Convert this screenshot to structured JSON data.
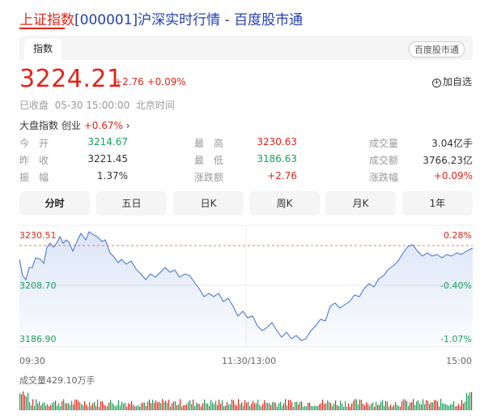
{
  "title": {
    "name": "上证指数",
    "code": "[000001]",
    "suffix": "沪深实时行情 - 百度股市通"
  },
  "tab": {
    "index_label": "指数",
    "brand_label": "百度股市通"
  },
  "quote": {
    "price": "3224.21",
    "change": "+2.76",
    "change_pct": "+0.09%"
  },
  "favorite_label": "加自选",
  "status": {
    "state": "已收盘",
    "time": "05-30 15:00:00",
    "tz": "北京时间"
  },
  "market": {
    "label": "大盘指数",
    "board": "创业",
    "board_chg": "+0.67%"
  },
  "stats": [
    {
      "l1": "今　开",
      "v1": "3214.67",
      "c1": "down",
      "l2": "最　高",
      "v2": "3230.63",
      "c2": "up",
      "l3": "成交量",
      "v3": "3.04亿手",
      "c3": ""
    },
    {
      "l1": "昨　收",
      "v1": "3221.45",
      "c1": "",
      "l2": "最　低",
      "v2": "3186.63",
      "c2": "down",
      "l3": "成交额",
      "v3": "3766.23亿",
      "c3": ""
    },
    {
      "l1": "振　幅",
      "v1": "1.37%",
      "c1": "",
      "l2": "涨跌额",
      "v2": "+2.76",
      "c2": "up",
      "l3": "涨跌幅",
      "v3": "+0.09%",
      "c3": "up"
    }
  ],
  "periods": [
    "分时",
    "五日",
    "日K",
    "周K",
    "月K",
    "1年"
  ],
  "chart": {
    "y_high": "3230.51",
    "y_mid": "3208.70",
    "y_low": "3186.90",
    "pct_high": "0.28%",
    "pct_mid": "-0.40%",
    "pct_low": "-1.07%",
    "time_start": "09:30",
    "time_mid": "11:30/13:00",
    "time_end": "15:00",
    "volume_label": "成交量429.10万手"
  },
  "colors": {
    "up": "#e1251b",
    "down": "#1a9e5a",
    "line": "#3b6ed6",
    "title": "#2440b3"
  }
}
